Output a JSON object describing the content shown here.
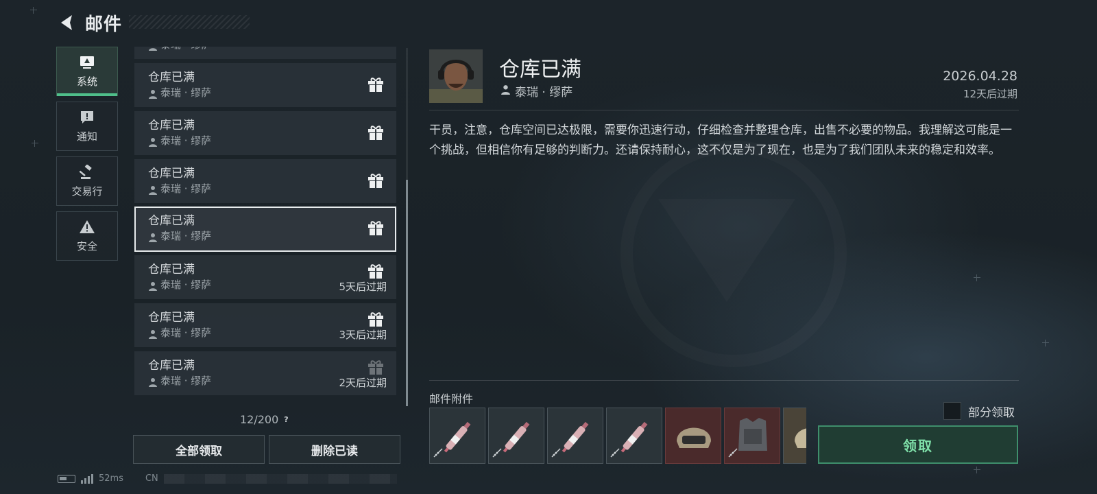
{
  "header": {
    "title": "邮件"
  },
  "categories": [
    {
      "label": "系统",
      "icon": "monitor-icon",
      "active": true
    },
    {
      "label": "通知",
      "icon": "alert-icon",
      "active": false
    },
    {
      "label": "交易行",
      "icon": "gavel-icon",
      "active": false
    },
    {
      "label": "安全",
      "icon": "warning-icon",
      "active": false
    }
  ],
  "mail_list": {
    "partial_top_sender": "泰瑞 · 缪萨",
    "items": [
      {
        "subject": "仓库已满",
        "sender": "泰瑞 · 缪萨",
        "expiry": "",
        "has_gift": true
      },
      {
        "subject": "仓库已满",
        "sender": "泰瑞 · 缪萨",
        "expiry": "",
        "has_gift": true
      },
      {
        "subject": "仓库已满",
        "sender": "泰瑞 · 缪萨",
        "expiry": "",
        "has_gift": true
      },
      {
        "subject": "仓库已满",
        "sender": "泰瑞 · 缪萨",
        "expiry": "",
        "has_gift": true,
        "selected": true
      },
      {
        "subject": "仓库已满",
        "sender": "泰瑞 · 缪萨",
        "expiry": "5天后过期",
        "has_gift": true
      },
      {
        "subject": "仓库已满",
        "sender": "泰瑞 · 缪萨",
        "expiry": "3天后过期",
        "has_gift": true
      },
      {
        "subject": "仓库已满",
        "sender": "泰瑞 · 缪萨",
        "expiry": "2天后过期",
        "has_gift": true,
        "gift_dim": true
      }
    ],
    "count": "12/200",
    "help": "?"
  },
  "actions": {
    "claim_all": "全部领取",
    "delete_read": "删除已读"
  },
  "status_bar": {
    "ping": "52ms",
    "server_prefix": "CN"
  },
  "detail": {
    "title": "仓库已满",
    "sender": "泰瑞 · 缪萨",
    "date": "2026.04.28",
    "expire": "12天后过期",
    "body": "干员，注意，仓库空间已达极限，需要你迅速行动，仔细检查并整理仓库，出售不必要的物品。我理解这可能是一个挑战，但相信你有足够的判断力。还请保持耐心，这不仅是为了现在，也是为了我们团队未来的稳定和效率。",
    "attachments_label": "邮件附件",
    "attachments": [
      {
        "icon": "injector-icon",
        "rarity": "gray"
      },
      {
        "icon": "injector-icon",
        "rarity": "gray"
      },
      {
        "icon": "injector-icon",
        "rarity": "gray"
      },
      {
        "icon": "injector-icon",
        "rarity": "gray"
      },
      {
        "icon": "helmet-icon",
        "rarity": "red"
      },
      {
        "icon": "body-armor-icon",
        "rarity": "red"
      },
      {
        "icon": "helmet-icon",
        "rarity": "tan"
      }
    ],
    "partial_claim_label": "部分领取",
    "partial_claim_checked": false,
    "claim_label": "领取"
  },
  "colors": {
    "accent": "#4fbf8a",
    "claim_text": "#7fe0a9",
    "claim_border": "#3f8f6c"
  }
}
